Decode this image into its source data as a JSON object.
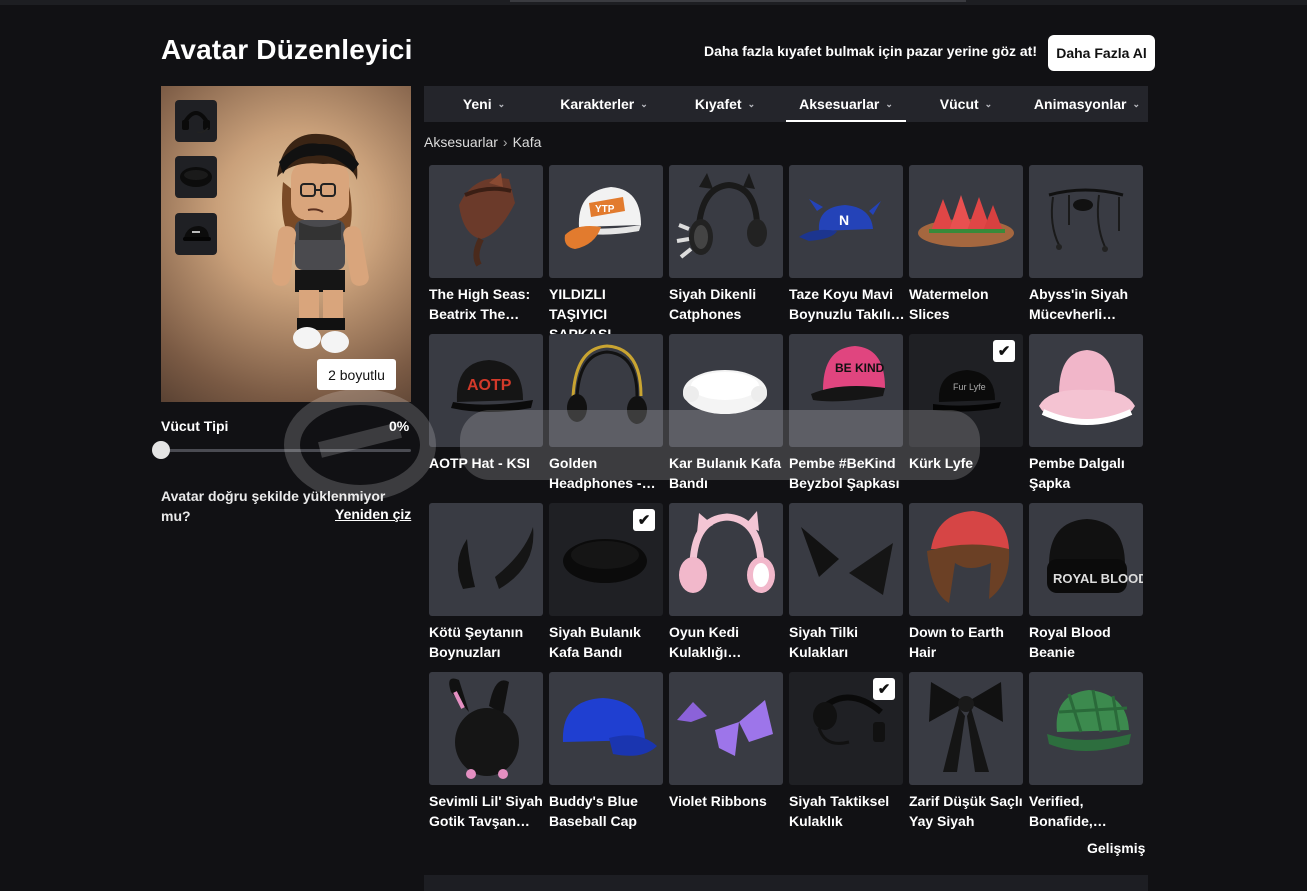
{
  "header": {
    "title": "Avatar Düzenleyici",
    "market_text": "Daha fazla kıyafet bulmak için pazar yerine göz at!",
    "get_more_label": "Daha Fazla Al"
  },
  "avatar": {
    "dimension_label": "2 boyutlu",
    "body_type_label": "Vücut Tipi",
    "body_type_value": "0%",
    "load_issue_text": "Avatar doğru şekilde yüklenmiyor mu?",
    "redraw_label": "Yeniden çiz"
  },
  "nav": {
    "tabs": [
      {
        "label": "Yeni"
      },
      {
        "label": "Karakterler"
      },
      {
        "label": "Kıyafet"
      },
      {
        "label": "Aksesuarlar"
      },
      {
        "label": "Vücut"
      },
      {
        "label": "Animasyonlar"
      }
    ],
    "active": "Aksesuarlar"
  },
  "breadcrumb": {
    "parent": "Aksesuarlar",
    "current": "Kafa"
  },
  "items": [
    {
      "name": "The High Seas: Beatrix The…",
      "icon": "pirate-hat-icon",
      "equipped": false
    },
    {
      "name": "YILDIZLI TAŞIYICI ŞAPKASI -…",
      "icon": "trucker-cap-icon",
      "equipped": false
    },
    {
      "name": "Siyah Dikenli Catphones",
      "icon": "spiked-headphones-icon",
      "equipped": false
    },
    {
      "name": "Taze Koyu Mavi Boynuzlu Takılı…",
      "icon": "horned-cap-icon",
      "equipped": false
    },
    {
      "name": "Watermelon Slices",
      "icon": "watermelon-icon",
      "equipped": false
    },
    {
      "name": "Abyss'in Siyah Mücevherli…",
      "icon": "jewelry-icon",
      "equipped": false
    },
    {
      "name": "AOTP Hat - KSI",
      "icon": "aotp-cap-icon",
      "equipped": false
    },
    {
      "name": "Golden Headphones -…",
      "icon": "golden-headphones-icon",
      "equipped": false
    },
    {
      "name": "Kar Bulanık Kafa Bandı",
      "icon": "white-headband-icon",
      "equipped": false
    },
    {
      "name": "Pembe #BeKind Beyzbol Şapkası",
      "icon": "pink-cap-icon",
      "equipped": false
    },
    {
      "name": "Kürk Lyfe",
      "icon": "black-cap-icon",
      "equipped": true
    },
    {
      "name": "Pembe Dalgalı Şapka",
      "icon": "pink-bucket-hat-icon",
      "equipped": false
    },
    {
      "name": "Kötü Şeytanın Boynuzları",
      "icon": "devil-horns-icon",
      "equipped": false
    },
    {
      "name": "Siyah Bulanık Kafa Bandı",
      "icon": "black-headband-icon",
      "equipped": true
    },
    {
      "name": "Oyun Kedi Kulaklığı…",
      "icon": "cat-headphones-icon",
      "equipped": false
    },
    {
      "name": "Siyah Tilki Kulakları",
      "icon": "fox-ears-icon",
      "equipped": false
    },
    {
      "name": "Down to Earth Hair",
      "icon": "brown-hair-icon",
      "equipped": false
    },
    {
      "name": "Royal Blood Beanie",
      "icon": "beanie-icon",
      "equipped": false
    },
    {
      "name": "Sevimli Lil' Siyah Gotik Tavşan…",
      "icon": "bunny-hood-icon",
      "equipped": false
    },
    {
      "name": "Buddy's Blue Baseball Cap",
      "icon": "blue-cap-icon",
      "equipped": false
    },
    {
      "name": "Violet Ribbons",
      "icon": "ribbons-icon",
      "equipped": false
    },
    {
      "name": "Siyah Taktiksel Kulaklık",
      "icon": "headset-icon",
      "equipped": true
    },
    {
      "name": "Zarif Düşük Saçlı Yay Siyah",
      "icon": "hair-bow-icon",
      "equipped": false
    },
    {
      "name": "Verified, Bonafide,…",
      "icon": "plaid-cap-icon",
      "equipped": false
    }
  ],
  "advanced_label": "Gelişmiş",
  "colors": {
    "background": "#111114",
    "tile": "#393b43",
    "nav": "#24252b",
    "accent": "#ffffff"
  }
}
